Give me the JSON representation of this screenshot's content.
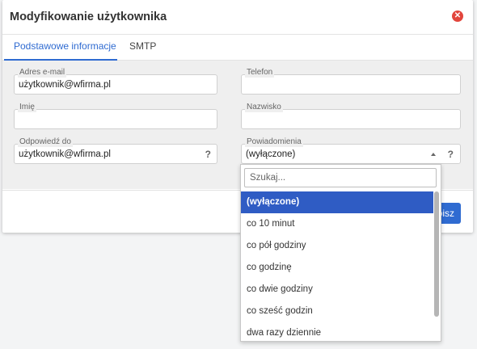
{
  "modal": {
    "title": "Modyfikowanie użytkownika",
    "close_symbol": "✕"
  },
  "tabs": [
    {
      "label": "Podstawowe informacje",
      "active": true
    },
    {
      "label": "SMTP",
      "active": false
    }
  ],
  "fields": {
    "email": {
      "label": "Adres e-mail",
      "value": "użytkownik@wfirma.pl"
    },
    "phone": {
      "label": "Telefon",
      "value": ""
    },
    "first_name": {
      "label": "Imię",
      "value": ""
    },
    "last_name": {
      "label": "Nazwisko",
      "value": ""
    },
    "reply_to": {
      "label": "Odpowiedź do",
      "value": "użytkownik@wfirma.pl",
      "help": "?"
    },
    "notifications": {
      "label": "Powiadomienia",
      "value": "(wyłączone)",
      "help": "?"
    }
  },
  "footer": {
    "save_label": "pisz"
  },
  "dropdown": {
    "search_placeholder": "Szukaj...",
    "options": [
      {
        "label": "(wyłączone)",
        "selected": true
      },
      {
        "label": "co 10 minut",
        "selected": false
      },
      {
        "label": "co pół godziny",
        "selected": false
      },
      {
        "label": "co godzinę",
        "selected": false
      },
      {
        "label": "co dwie godziny",
        "selected": false
      },
      {
        "label": "co sześć godzin",
        "selected": false
      },
      {
        "label": "dwa razy dziennie",
        "selected": false
      }
    ]
  },
  "colors": {
    "accent": "#2f6bd1",
    "selected_option": "#2f5cc4",
    "close": "#e2453c"
  }
}
